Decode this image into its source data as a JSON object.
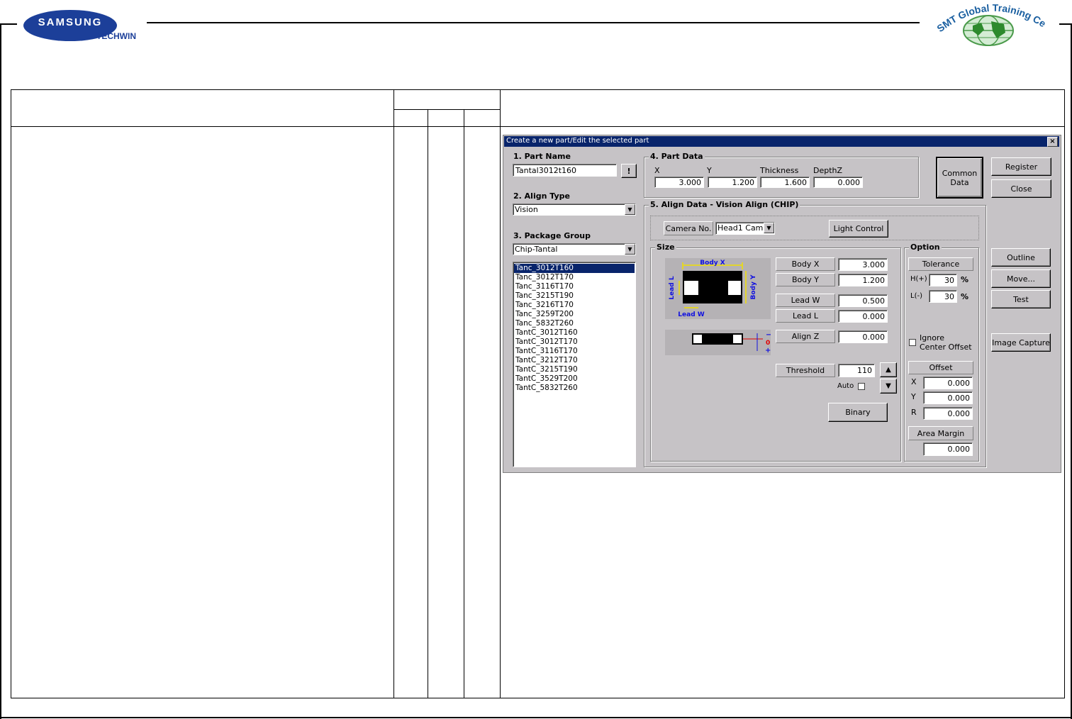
{
  "header": {
    "logo_main": "SAMSUNG",
    "logo_sub": "TECHWIN",
    "center_logo_text": "SMT Global Training Center"
  },
  "dialog": {
    "title": "Create a new part/Edit the selected part",
    "close_glyph": "×",
    "part_name": {
      "label": "1. Part Name",
      "value": "Tantal3012t160",
      "button": "!"
    },
    "align_type": {
      "label": "2. Align Type",
      "value": "Vision"
    },
    "package_group": {
      "label": "3. Package Group",
      "value": "Chip-Tantal",
      "items": [
        "Tanc_3012T160",
        "Tanc_3012T170",
        "Tanc_3116T170",
        "Tanc_3215T190",
        "Tanc_3216T170",
        "Tanc_3259T200",
        "Tanc_5832T260",
        "TantC_3012T160",
        "TantC_3012T170",
        "TantC_3116T170",
        "TantC_3212T170",
        "TantC_3215T190",
        "TantC_3529T200",
        "TantC_5832T260"
      ],
      "selected_index": 0
    },
    "part_data": {
      "label": "4. Part Data",
      "x_label": "X",
      "x": "3.000",
      "y_label": "Y",
      "y": "1.200",
      "thickness_label": "Thickness",
      "thickness": "1.600",
      "depthz_label": "DepthZ",
      "depthz": "0.000"
    },
    "common_data_button": "Common\nData",
    "register_button": "Register",
    "close_button": "Close",
    "align_data": {
      "label": "5. Align Data - Vision Align (CHIP)",
      "camera_label": "Camera No.",
      "camera_value": "Head1 Cam",
      "light_control": "Light Control",
      "size": {
        "label": "Size",
        "fig_body_x": "Body X",
        "fig_body_y": "Body Y",
        "fig_lead_l": "Lead L",
        "fig_lead_w": "Lead W",
        "fig_minus": "−",
        "fig_zero": "0",
        "fig_plus": "+",
        "body_x_label": "Body X",
        "body_x": "3.000",
        "body_y_label": "Body Y",
        "body_y": "1.200",
        "lead_w_label": "Lead W",
        "lead_w": "0.500",
        "lead_l_label": "Lead L",
        "lead_l": "0.000",
        "align_z_label": "Align Z",
        "align_z": "0.000",
        "threshold_label": "Threshold",
        "threshold": "110",
        "auto_label": "Auto",
        "binary_button": "Binary"
      },
      "option": {
        "label": "Option",
        "tolerance_label": "Tolerance",
        "h_label": "H(+)",
        "h_value": "30",
        "h_unit": "%",
        "l_label": "L(-)",
        "l_value": "30",
        "l_unit": "%",
        "ignore_label": "Ignore\nCenter Offset",
        "offset_label": "Offset",
        "off_x_label": "X",
        "off_x": "0.000",
        "off_y_label": "Y",
        "off_y": "0.000",
        "off_r_label": "R",
        "off_r": "0.000",
        "area_margin_label": "Area Margin",
        "area_margin": "0.000"
      }
    },
    "outline_button": "Outline",
    "move_button": "Move...",
    "test_button": "Test",
    "image_capture_button": "Image Capture"
  }
}
